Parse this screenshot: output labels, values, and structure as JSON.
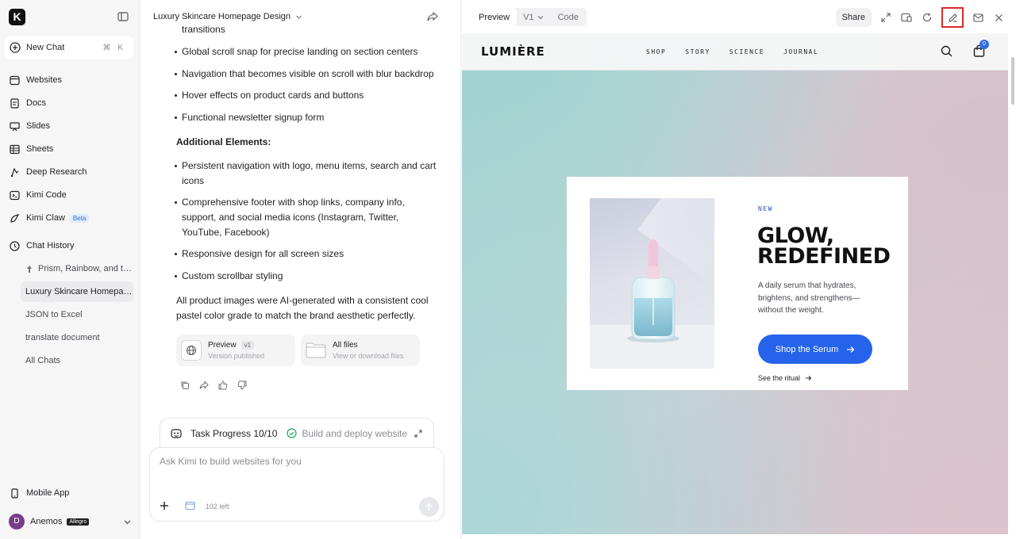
{
  "sidebar": {
    "logo_letter": "K",
    "new_chat": {
      "label": "New Chat",
      "shortcut": "⌘ K"
    },
    "nav": [
      {
        "label": "Websites",
        "icon": "browser-icon"
      },
      {
        "label": "Docs",
        "icon": "doc-icon"
      },
      {
        "label": "Slides",
        "icon": "slides-icon"
      },
      {
        "label": "Sheets",
        "icon": "table-icon"
      },
      {
        "label": "Deep Research",
        "icon": "research-icon"
      },
      {
        "label": "Kimi Code",
        "icon": "code-icon"
      },
      {
        "label": "Kimi Claw",
        "icon": "claw-icon",
        "badge": "Beta"
      }
    ],
    "history_title": "Chat History",
    "history": [
      {
        "label": "Prism, Rainbow, and the...",
        "pinned": true
      },
      {
        "label": "Luxury Skincare Homepage...",
        "active": true
      },
      {
        "label": "JSON to Excel"
      },
      {
        "label": "translate document"
      },
      {
        "label": "All Chats"
      }
    ],
    "mobile_app": "Mobile App",
    "user": {
      "initial": "D",
      "name": "Anemos",
      "plan": "Allegro"
    }
  },
  "chat": {
    "title": "Luxury Skincare Homepage Design",
    "top_fragment": "transitions",
    "features": [
      "Global scroll snap for precise landing on section centers",
      "Navigation that becomes visible on scroll with blur backdrop",
      "Hover effects on product cards and buttons",
      "Functional newsletter signup form"
    ],
    "additional_heading": "Additional Elements:",
    "additional": [
      "Persistent navigation with logo, menu items, search and cart icons",
      "Comprehensive footer with shop links, company info, support, and social media icons (Instagram, Twitter, YouTube, Facebook)",
      "Responsive design for all screen sizes",
      "Custom scrollbar styling"
    ],
    "closing": "All product images were AI-generated with a consistent cool pastel color grade to match the brand aesthetic perfectly.",
    "cards": [
      {
        "title": "Preview",
        "tag": "v1",
        "subtitle": "Version published"
      },
      {
        "title": "All files",
        "subtitle": "View or download files"
      }
    ],
    "task": {
      "progress": "Task Progress 10/10",
      "status": "Build and deploy website"
    },
    "composer": {
      "placeholder": "Ask Kimi to build websites for you",
      "remaining": "102 left"
    }
  },
  "preview": {
    "tabs": {
      "preview": "Preview",
      "version": "V1",
      "code": "Code"
    },
    "share": "Share",
    "site": {
      "brand": "LUMIÈRE",
      "menu": [
        "SHOP",
        "STORY",
        "SCIENCE",
        "JOURNAL"
      ],
      "cart_count": "0",
      "tag": "NEW",
      "headline_1": "GLOW,",
      "headline_2": "REDEFINED",
      "subtitle": "A daily serum that hydrates, brightens, and strengthens—without the weight.",
      "cta": "Shop the Serum",
      "link": "See the ritual"
    },
    "colors": {
      "accent": "#2563eb",
      "highlight": "#d92b2b"
    }
  }
}
